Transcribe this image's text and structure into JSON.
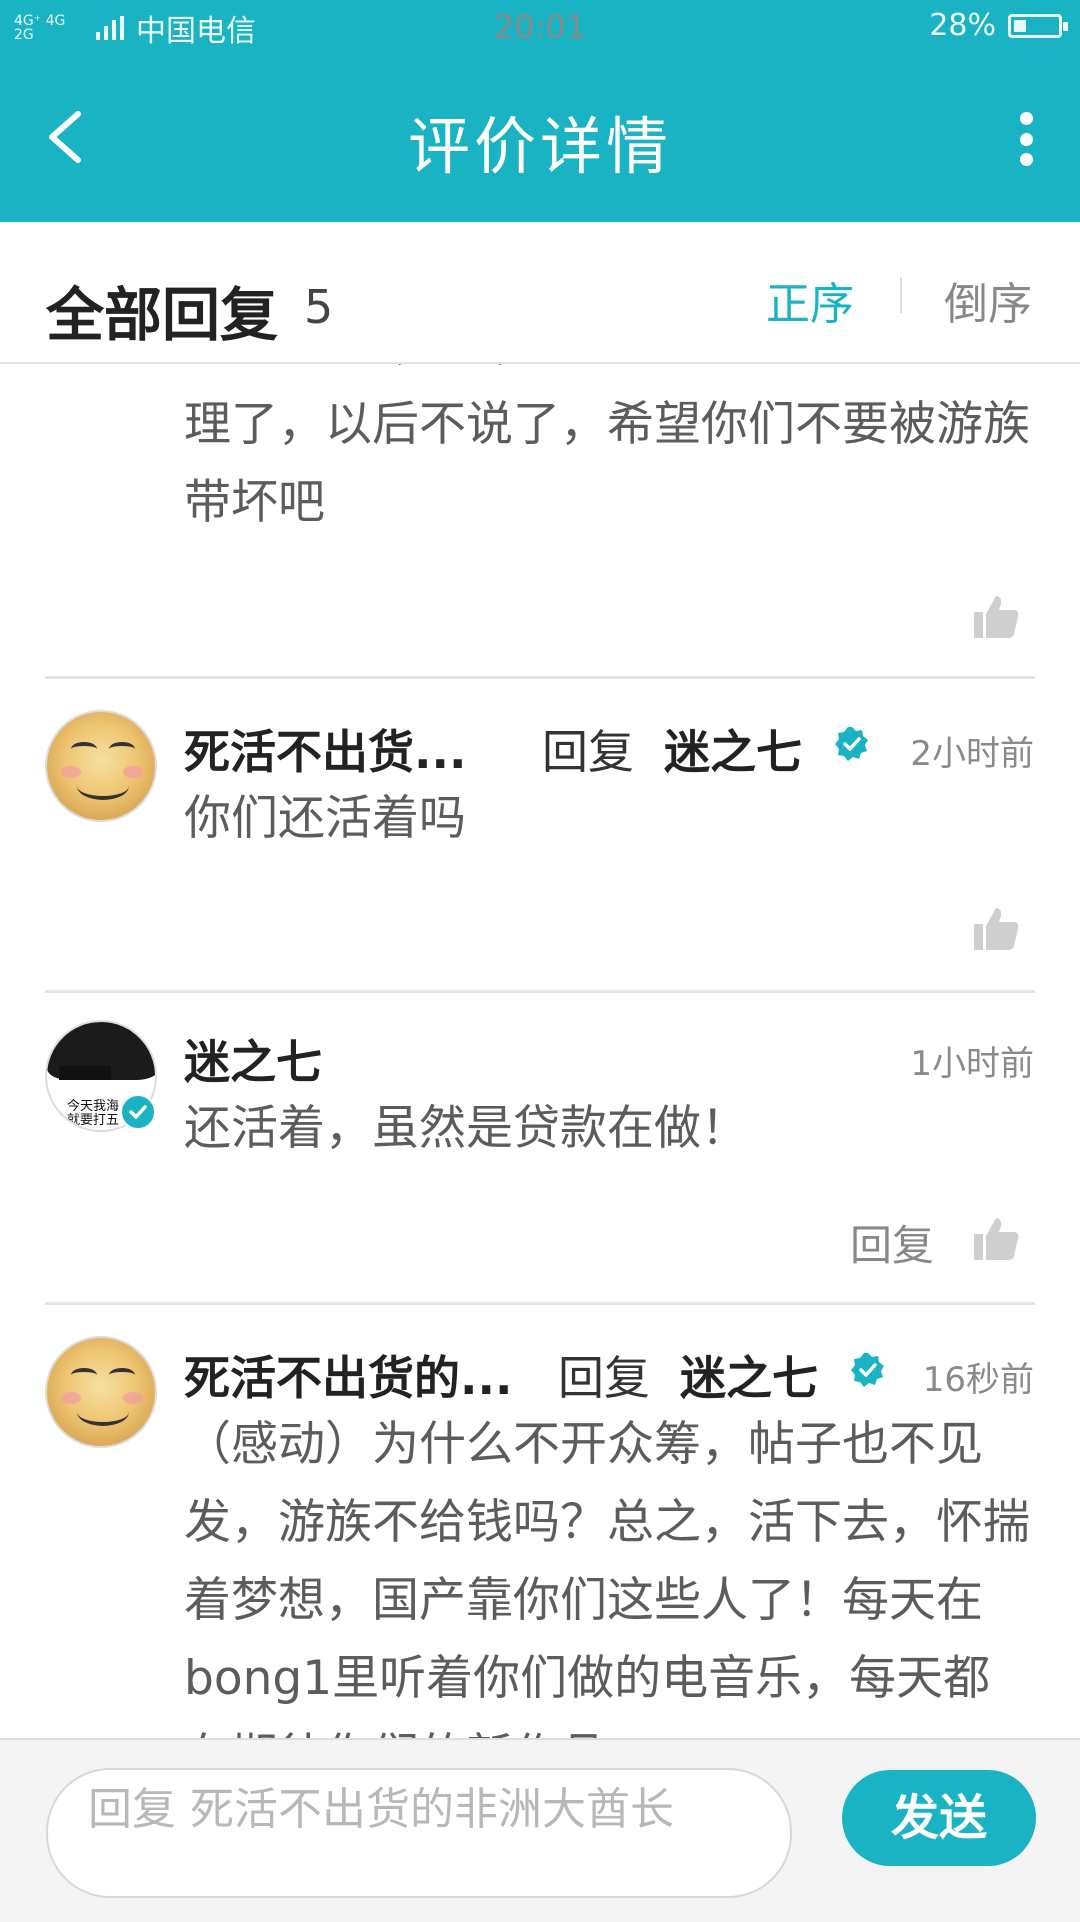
{
  "status_bar": {
    "network": "4G⁺ 4G\n2G",
    "carrier": "中国电信",
    "time": "20:01",
    "battery": "28%",
    "battery_level": 0.28
  },
  "app_bar": {
    "title": "评价详情"
  },
  "header": {
    "title": "全部回复",
    "count": "5",
    "sort_asc": "正序",
    "sort_desc": "倒序"
  },
  "comments": [
    {
      "partial_text": "ehhhhhh，so，看来你被吓了吧情有可原",
      "text": "理了，以后不说了，希望你们不要被游族带坏吧"
    },
    {
      "name": "死活不出货...",
      "reply_word": "回复",
      "target": "迷之七",
      "time": "2小时前",
      "text": "你们还活着吗"
    },
    {
      "name": "迷之七",
      "time": "1小时前",
      "text": "还活着，虽然是贷款在做！",
      "reply_label": "回复",
      "avatar_caption": "今天我海\n就要打五"
    },
    {
      "name": "死活不出货的...",
      "reply_word": "回复",
      "target": "迷之七",
      "time": "16秒前",
      "text": "（感动）为什么不开众筹，帖子也不见发，游族不给钱吗？总之，活下去，怀揣着梦想，国产靠你们这些人了！每天在bong1里听着你们做的电音乐，每天都在期待你们的新作品"
    }
  ],
  "input": {
    "placeholder": "回复 死活不出货的非洲大酋长"
  },
  "send_label": "发送",
  "colors": {
    "accent": "#19b3c4",
    "verified": "#19b3c4"
  },
  "icons": [
    "back-arrow-icon",
    "more-vertical-icon",
    "thumbs-up-icon",
    "verified-badge-icon",
    "battery-icon",
    "signal-icon"
  ]
}
